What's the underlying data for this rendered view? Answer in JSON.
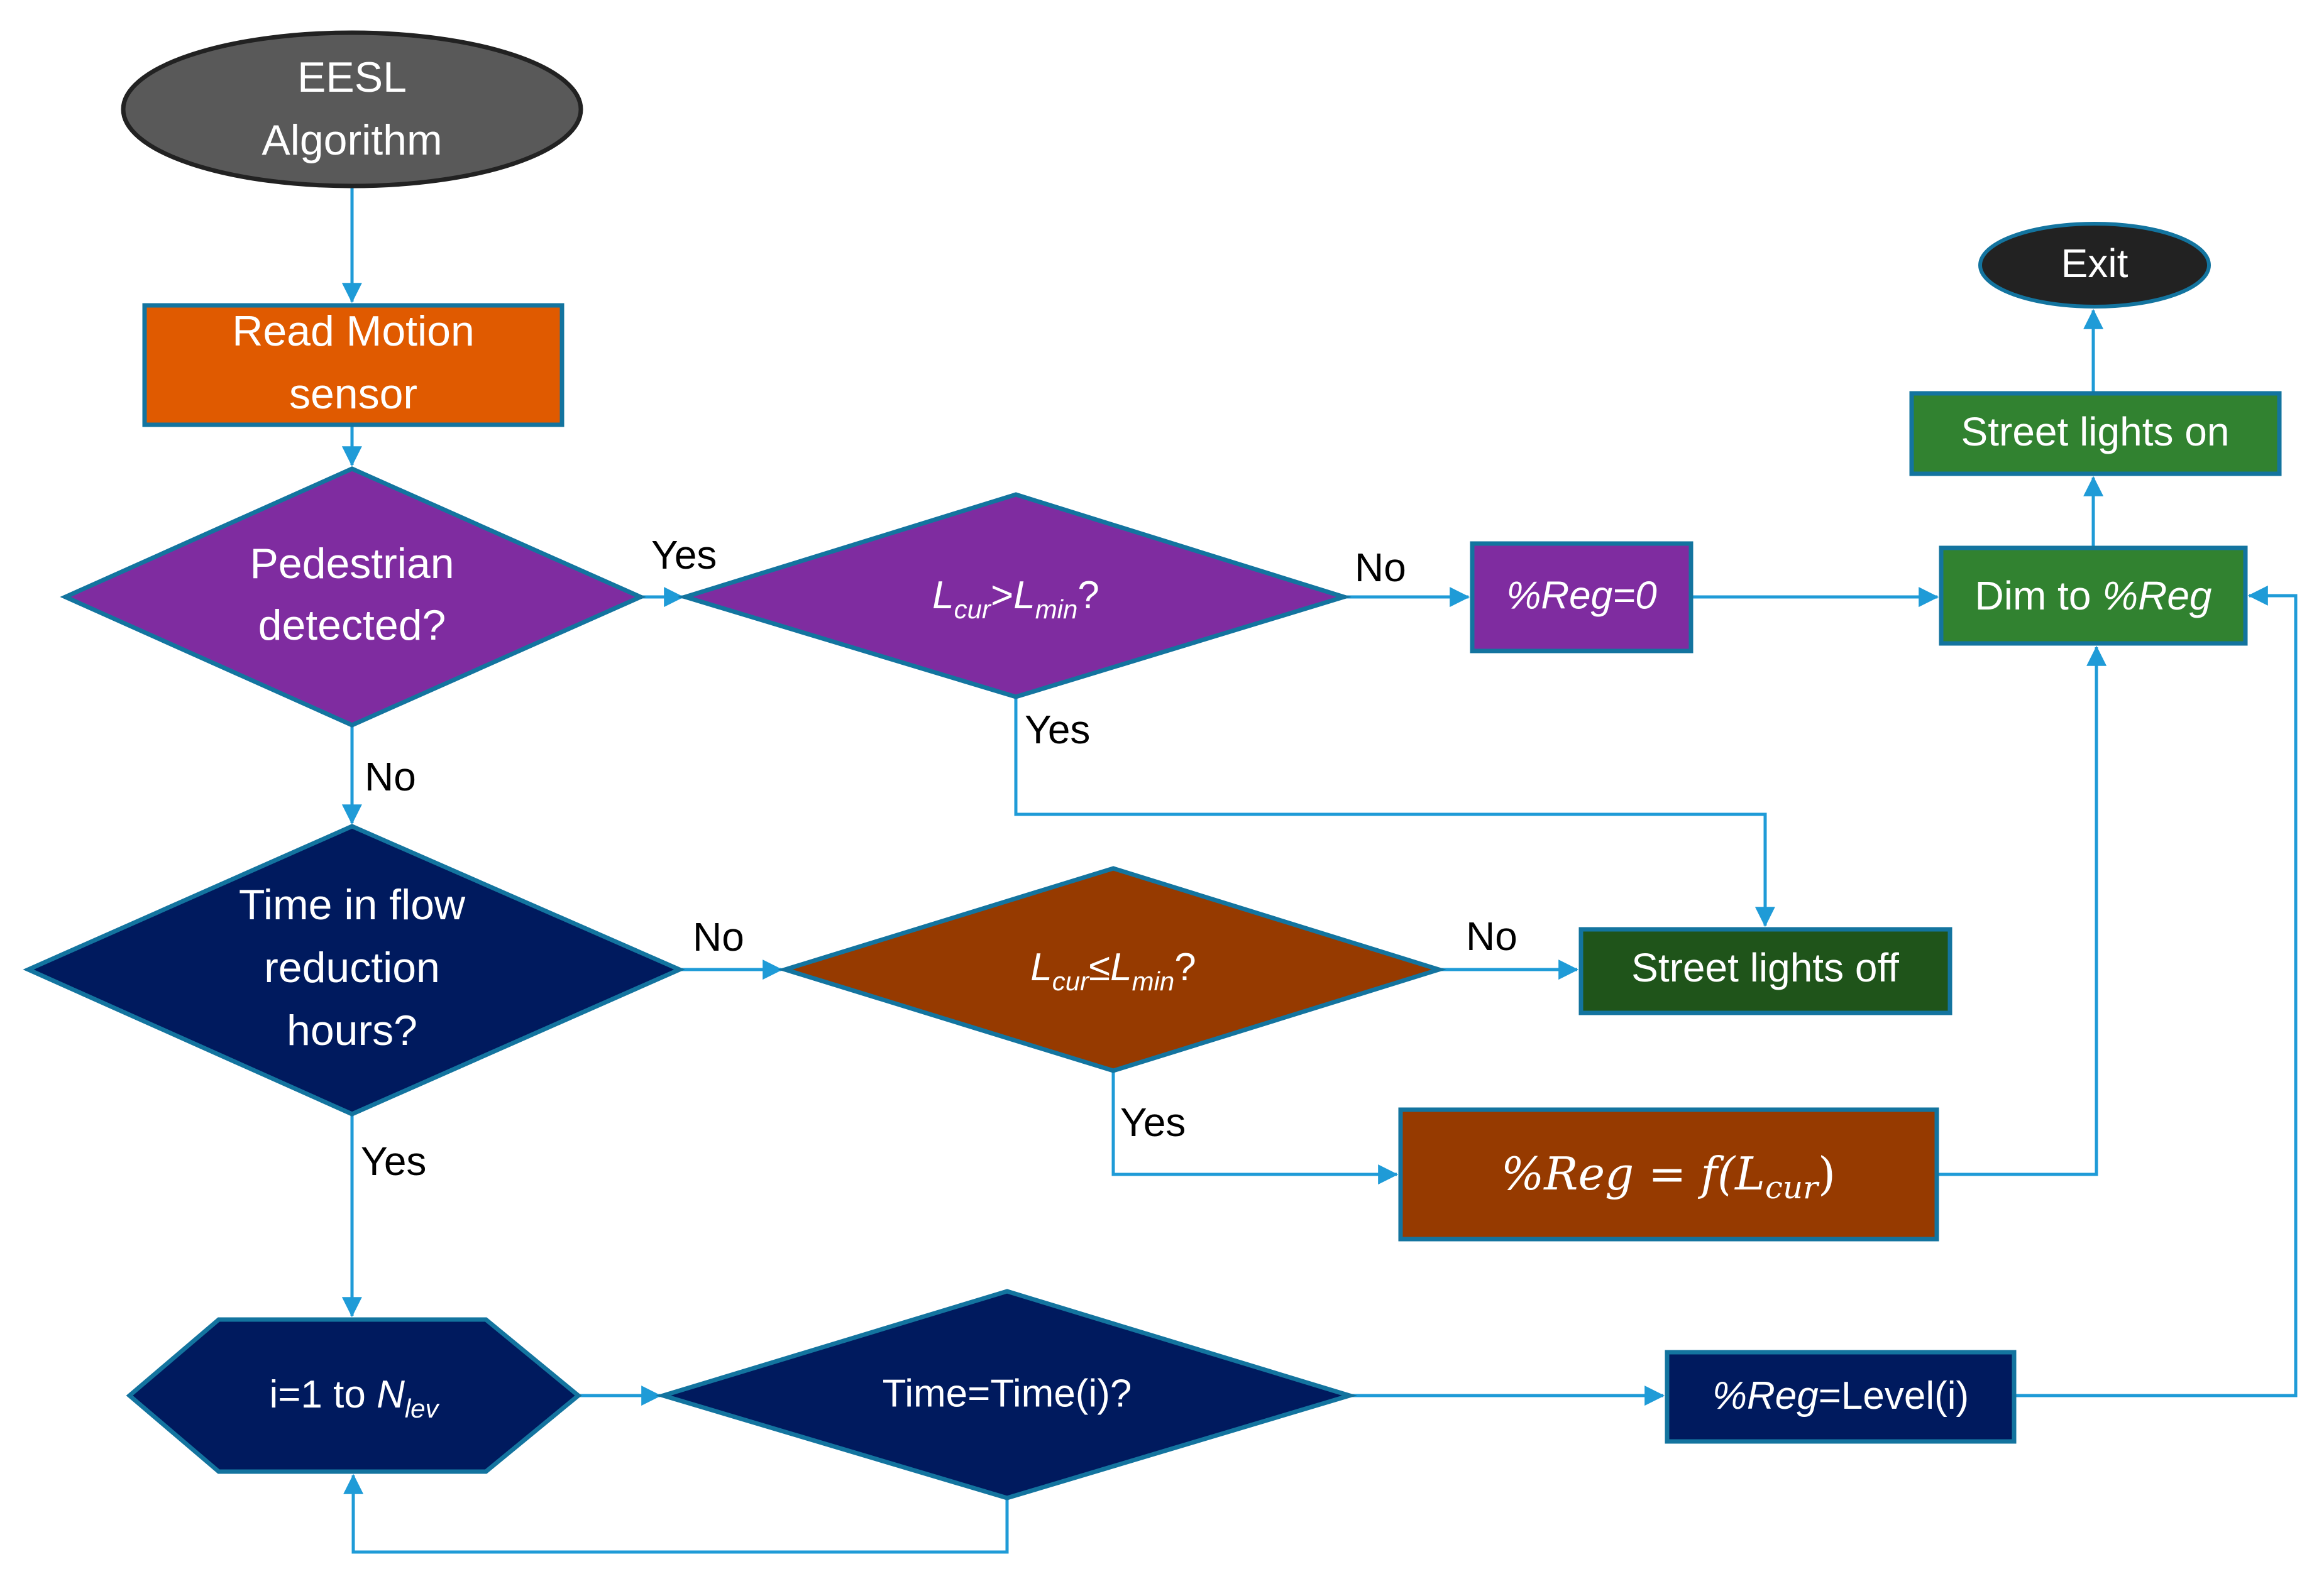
{
  "diagram": {
    "title": "EESL Algorithm flowchart",
    "colors": {
      "connector": "#1f9bd7",
      "shape_border": "#13749f",
      "start_fill": "#595959",
      "exit_fill": "#222222",
      "orange": "#e05a00",
      "purple": "#7f2ca0",
      "navy": "#001a5e",
      "brown": "#963a00",
      "green": "#318230",
      "dark_green": "#1f541a"
    },
    "nodes": {
      "start": {
        "line1": "EESL",
        "line2": "Algorithm"
      },
      "read_sensor": {
        "line1": "Read Motion",
        "line2": "sensor"
      },
      "pedestrian": {
        "line1": "Pedestrian",
        "line2": "detected?"
      },
      "lcur_gt_lmin": {
        "L1": "L",
        "sub1": "cur",
        "op": ">",
        "L2": "L",
        "sub2": "min",
        "q": "?"
      },
      "reg_zero": {
        "text": "%Reg=0"
      },
      "dim_to_reg": {
        "prefix": "Dim to ",
        "var": "%Reg"
      },
      "lights_on": {
        "text": "Street lights on"
      },
      "exit": {
        "text": "Exit"
      },
      "flow_reduction": {
        "line1": "Time in flow",
        "line2": "reduction",
        "line3": "hours?"
      },
      "lcur_le_lmin": {
        "L1": "L",
        "sub1": "cur",
        "op": "≤",
        "L2": "L",
        "sub2": "min",
        "q": "?"
      },
      "lights_off": {
        "text": "Street lights off"
      },
      "reg_func": {
        "lhs": "%Reg",
        "eq": " = ",
        "f": "f(",
        "L": "L",
        "sub": "cur",
        "close": ")"
      },
      "loop": {
        "prefix": "i=1 to ",
        "N": "N",
        "sub": "lev"
      },
      "time_eq": {
        "text": "Time=Time(i)?"
      },
      "reg_level": {
        "var": "%Reg",
        "rest": "=Level(i)"
      }
    },
    "edge_labels": {
      "ped_yes": "Yes",
      "ped_no": "No",
      "lgt_no": "No",
      "lgt_yes": "Yes",
      "flow_no": "No",
      "flow_yes": "Yes",
      "lle_no": "No",
      "lle_yes": "Yes"
    }
  }
}
